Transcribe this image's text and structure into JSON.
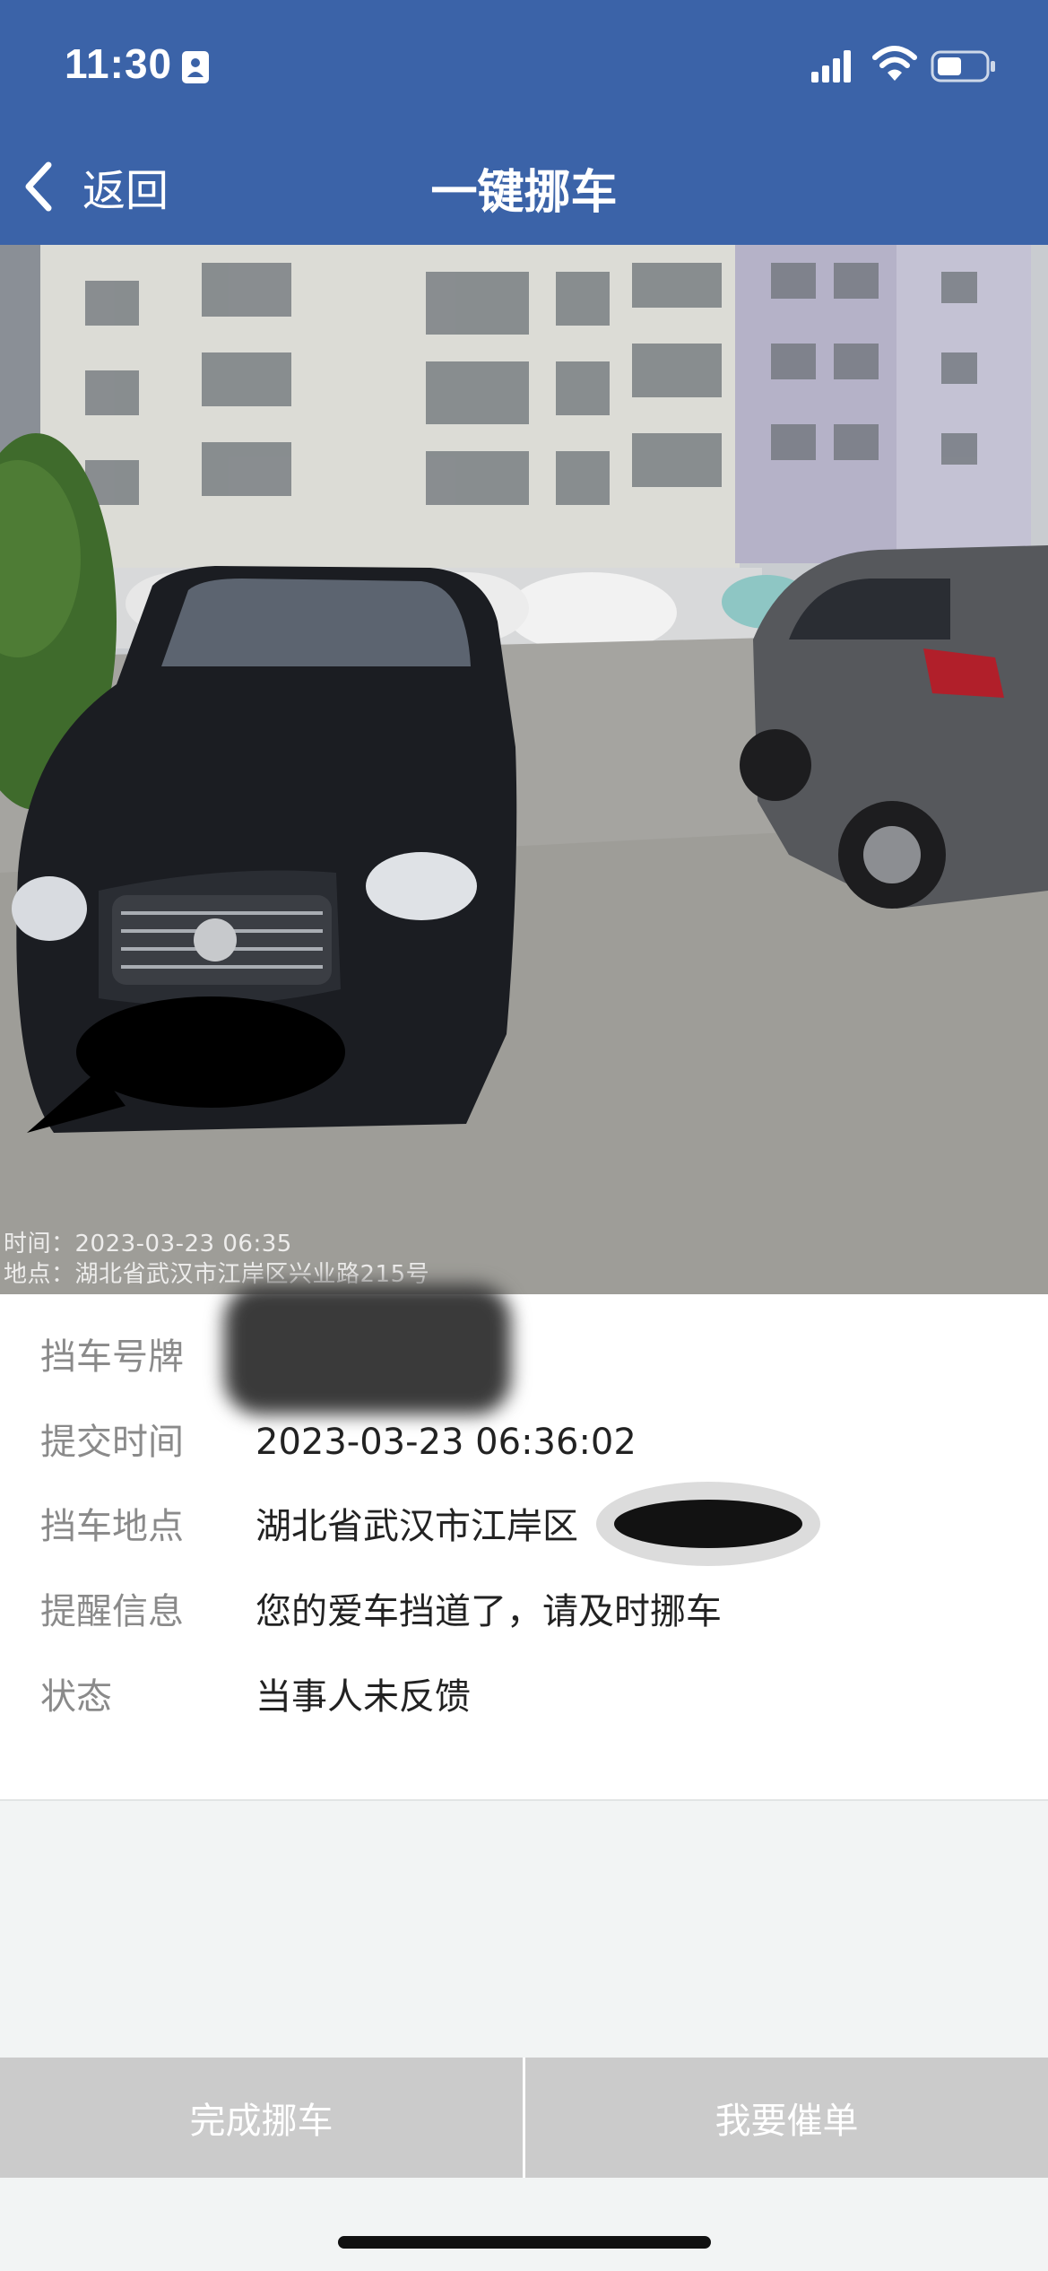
{
  "status_bar": {
    "time": "11:30",
    "icons": [
      "id-card-icon",
      "cellular-signal-icon",
      "wifi-icon",
      "battery-icon"
    ]
  },
  "nav": {
    "back_label": "返回",
    "title": "一键挪车"
  },
  "photo": {
    "stamp_time": "时间：2023-03-23 06:35",
    "stamp_place": "地点：湖北省武汉市江岸区兴业路215号"
  },
  "details": [
    {
      "label": "挡车号牌",
      "value": ""
    },
    {
      "label": "提交时间",
      "value": "2023-03-23 06:36:02"
    },
    {
      "label": "挡车地点",
      "value": "湖北省武汉市江岸区"
    },
    {
      "label": "提醒信息",
      "value": "您的爱车挡道了，请及时挪车"
    },
    {
      "label": "状态",
      "value": "当事人未反馈"
    }
  ],
  "actions": {
    "complete_label": "完成挪车",
    "urge_label": "我要催单"
  },
  "colors": {
    "header": "#3b63a8",
    "button_bg": "#cbcbcb",
    "page_bg": "#f2f4f4"
  }
}
